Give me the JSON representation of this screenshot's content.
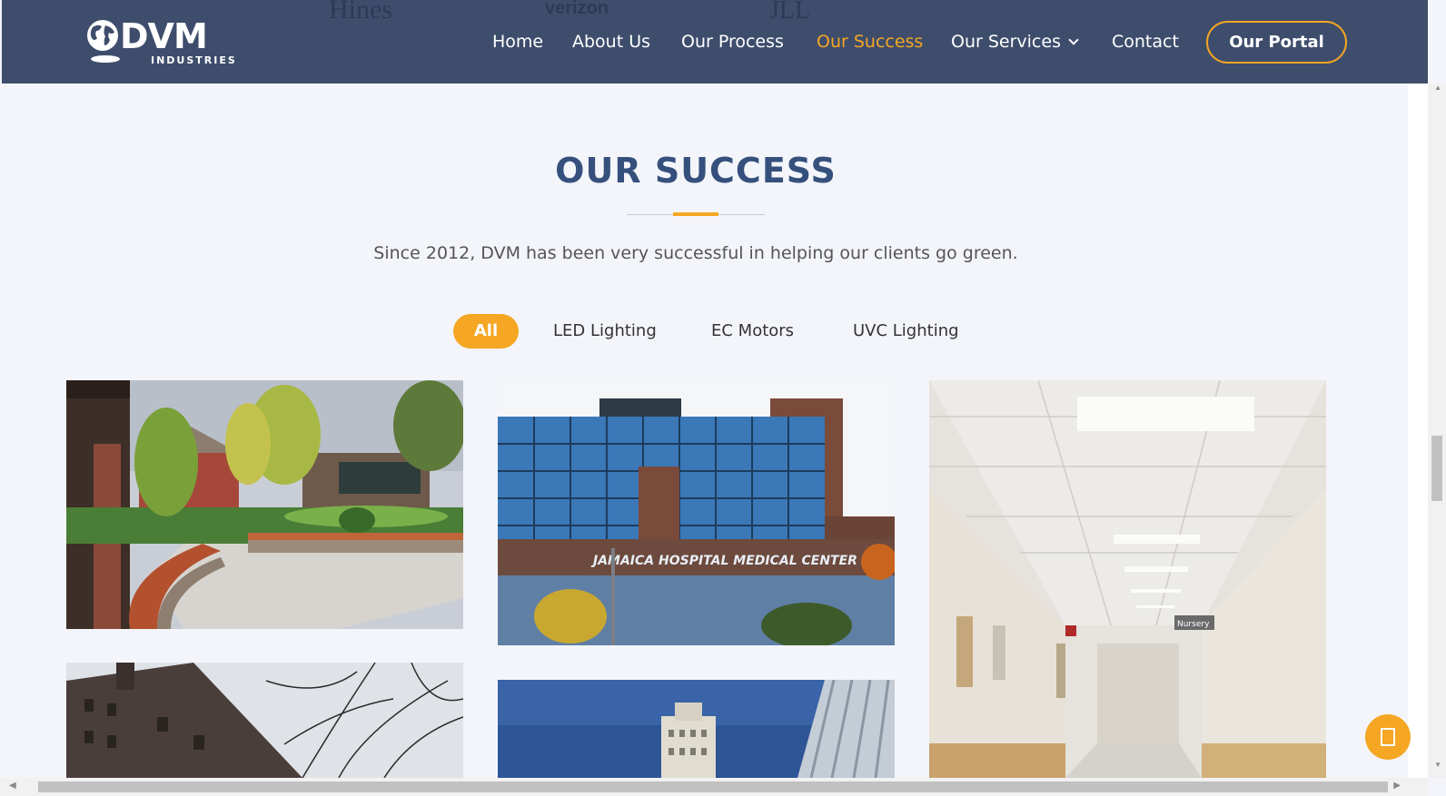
{
  "header": {
    "bg_logos": [
      "Hines",
      "verizon",
      "JLL"
    ],
    "logo": {
      "name": "DVM",
      "sub": "INDUSTRIES"
    },
    "nav": [
      {
        "label": "Home",
        "active": false
      },
      {
        "label": "About Us",
        "active": false
      },
      {
        "label": "Our Process",
        "active": false
      },
      {
        "label": "Our Success",
        "active": true
      },
      {
        "label": "Our Services",
        "active": false,
        "has_dropdown": true
      },
      {
        "label": "Contact",
        "active": false
      }
    ],
    "portal_label": "Our Portal"
  },
  "main": {
    "title": "OUR SUCCESS",
    "subtitle": "Since 2012, DVM has been very successful in helping our clients go green.",
    "filters": [
      {
        "label": "All",
        "active": true
      },
      {
        "label": "LED Lighting",
        "active": false
      },
      {
        "label": "EC Motors",
        "active": false
      },
      {
        "label": "UVC Lighting",
        "active": false
      }
    ],
    "projects": [
      {
        "image": "courtyard-garden"
      },
      {
        "image": "hospital-building",
        "sign_text": "JAMAICA HOSPITAL MEDICAL CENTER"
      },
      {
        "image": "hospital-corridor",
        "sign_text": "Nursery"
      },
      {
        "image": "brick-building"
      },
      {
        "image": "tower-sky"
      }
    ]
  },
  "colors": {
    "header_bg": "#3e4d6c",
    "accent": "#f5a623",
    "title": "#35507c",
    "page_bg": "#f3f5fa"
  },
  "icons": {
    "globe": "globe-icon",
    "dropdown": "chevron-down-icon",
    "chat": "chat-icon"
  }
}
